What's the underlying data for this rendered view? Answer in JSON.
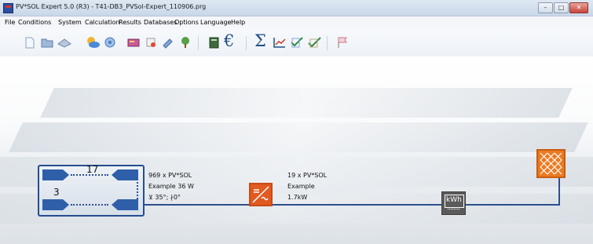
{
  "window": {
    "title": "PV*SOL Expert 5.0  (R3) - T41-DB3_PVSol-Expert_110906.prg",
    "buttons": {
      "minimize": "–",
      "maximize": "□",
      "close": "✕"
    }
  },
  "menu": [
    "File",
    "Conditions",
    "System",
    "Calculation",
    "Results",
    "Databases",
    "Options",
    "Language",
    "Help"
  ],
  "toolbar": {
    "euro_glyph": "€",
    "sigma_glyph": "Σ",
    "icons": [
      "new-file-icon",
      "open-folder-icon",
      "save-icon",
      "climate-data-icon",
      "pv-module-icon",
      "financial-data-icon",
      "wizard-icon",
      "tool-icon",
      "tree-icon",
      "book-icon",
      "euro-icon",
      "sum-icon",
      "diagram-icon",
      "check-icon",
      "check-all-icon",
      "flag-icon"
    ]
  },
  "pv_array": {
    "modules_per_string": "17",
    "strings": "3",
    "line1": "969 x PV*SOL",
    "line2": "Example 36 W",
    "line3": "⊻ 35°; ∤0°"
  },
  "inverter": {
    "line1": "19 x PV*SOL",
    "line2": "Example",
    "line3": "1.7kW"
  },
  "meter": {
    "label": "kWh"
  },
  "colors": {
    "wire": "#2c4f8d",
    "inverter": "#e15a22",
    "grid": "#ec7a22",
    "meter": "#5a5a5a",
    "panel_border": "#264d8f"
  }
}
